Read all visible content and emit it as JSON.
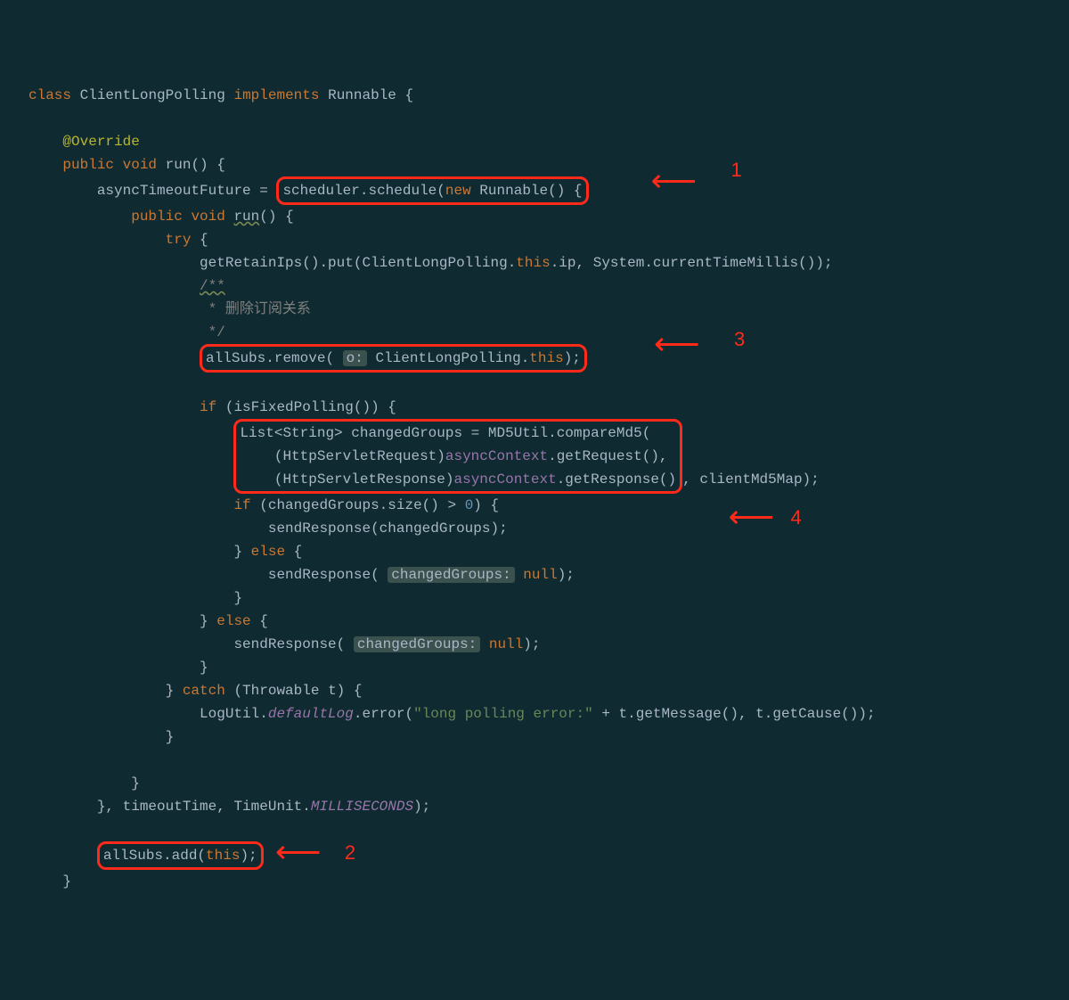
{
  "annotations": {
    "a1": {
      "label": "1"
    },
    "a2": {
      "label": "2"
    },
    "a3": {
      "label": "3"
    },
    "a4": {
      "label": "4"
    }
  },
  "code": {
    "l1_class": "class",
    "l1_name": "ClientLongPolling",
    "l1_impl": "implements",
    "l1_runnable": "Runnable",
    "l1_brace": " {",
    "l3_override": "@Override",
    "l4_public": "public",
    "l4_void": "void",
    "l4_run": " run() {",
    "l5_lhs": "asyncTimeoutFuture = ",
    "l5_box": "scheduler.schedule(",
    "l5_new": "new",
    "l5_runnable": " Runnable() {",
    "l6_public": "public",
    "l6_void": "void",
    "l6_run_u": "run",
    "l6_rest": "() {",
    "l7_try": "try",
    "l7_brace": " {",
    "l8": "getRetainIps().put(ClientLongPolling.",
    "l8_this": "this",
    "l8_b": ".ip, System.currentTimeMillis());",
    "l9a": "/**",
    "l9b": " * 删除订阅关系",
    "l9c": " */",
    "l10_a": "allSubs.remove( ",
    "l10_hint": "o:",
    "l10_b": " ClientLongPolling.",
    "l10_this": "this",
    "l10_c": ");",
    "l12_if": "if",
    "l12_rest": " (isFixedPolling()) {",
    "l13": "List<String> changedGroups = MD5Util.compareMd5(",
    "l14a": "    (HttpServletRequest)",
    "l14b": "asyncContext",
    "l14c": ".getRequest(),",
    "l15a": "    (HttpServletResponse)",
    "l15b": "asyncContext",
    "l15c": ".getResponse()",
    "l15d": ", clientMd5Map);",
    "l16_if": "if",
    "l16_rest": " (changedGroups.size() > ",
    "l16_zero": "0",
    "l16_rest2": ") {",
    "l17": "    sendResponse(changedGroups);",
    "l18_else": "} ",
    "l18_elsekw": "else",
    "l18_brace": " {",
    "l19a": "    sendResponse( ",
    "l19_hint": "changedGroups:",
    "l19b": " ",
    "l19_null": "null",
    "l19c": ");",
    "l20": "}",
    "l21_else": "} ",
    "l21_elsekw": "else",
    "l21_brace": " {",
    "l22a": "    sendResponse( ",
    "l22_hint": "changedGroups:",
    "l22b": " ",
    "l22_null": "null",
    "l22c": ");",
    "l23": "}",
    "l24_catch": "} ",
    "l24_kw": "catch",
    "l24_rest": " (Throwable t) {",
    "l25a": "LogUtil.",
    "l25_field": "defaultLog",
    "l25b": ".error(",
    "l25_str": "\"long polling error:\"",
    "l25c": " + t.getMessage(), t.getCause());",
    "l26": "}",
    "l28": "}",
    "l29a": "}, timeoutTime, TimeUnit.",
    "l29_ms": "MILLISECONDS",
    "l29b": ");",
    "l31_a": "allSubs.add(",
    "l31_this": "this",
    "l31_b": ");",
    "l32": "}"
  }
}
